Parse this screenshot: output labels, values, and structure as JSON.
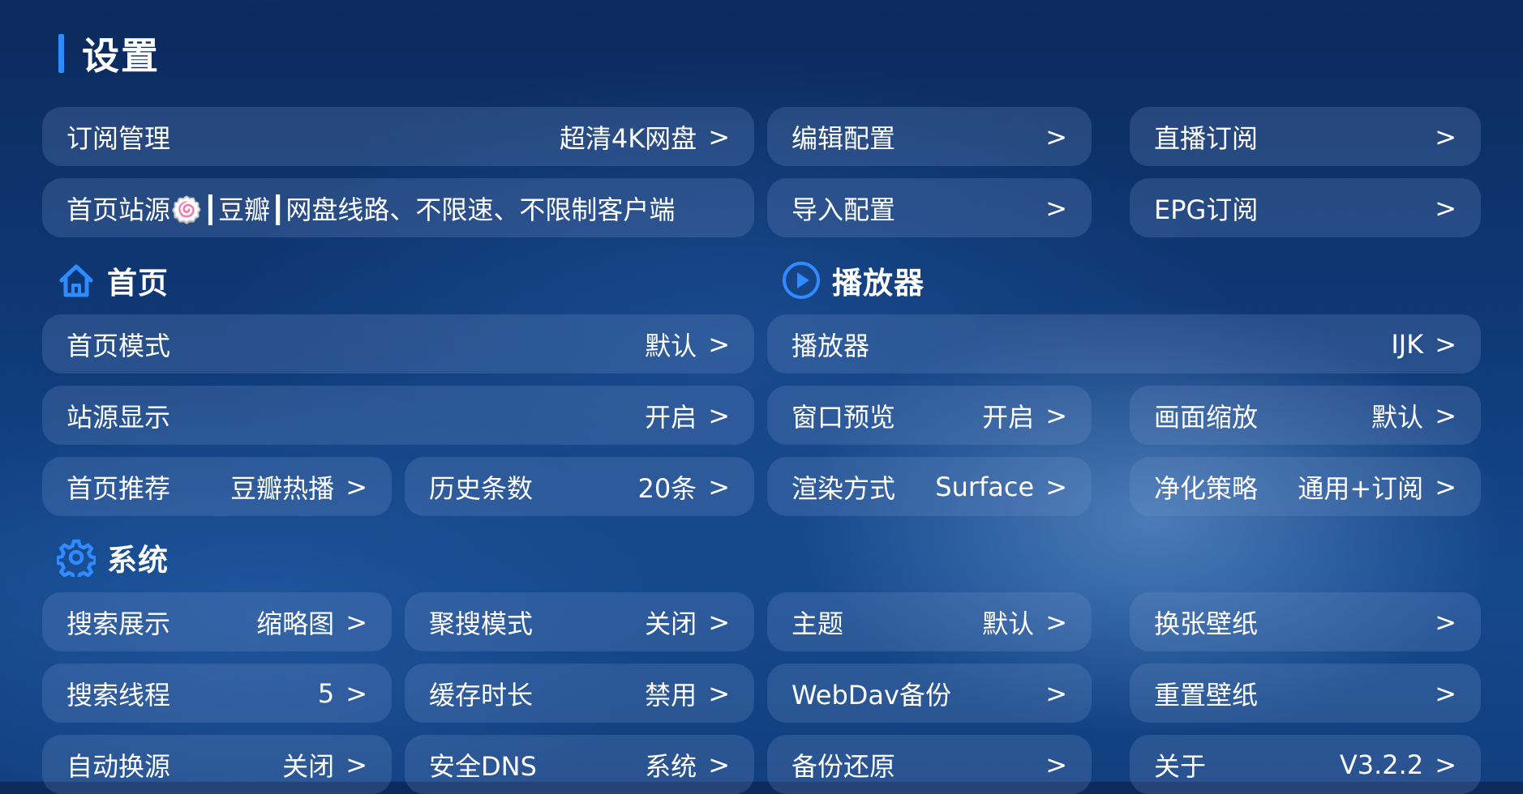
{
  "header": {
    "title": "设置"
  },
  "top": [
    {
      "label": "订阅管理",
      "value": "超清4K网盘"
    },
    {
      "label": "编辑配置",
      "value": ""
    },
    {
      "label": "直播订阅",
      "value": ""
    },
    {
      "label": "首页站源🍥┃豆瓣┃网盘线路、不限速、不限制客户端",
      "value": ""
    },
    {
      "label": "导入配置",
      "value": ""
    },
    {
      "label": "EPG订阅",
      "value": ""
    }
  ],
  "sections": {
    "home": "首页",
    "player": "播放器",
    "system": "系统"
  },
  "home": [
    {
      "label": "首页模式",
      "value": "默认"
    },
    {
      "label": "站源显示",
      "value": "开启"
    },
    {
      "label": "首页推荐",
      "value": "豆瓣热播"
    },
    {
      "label": "历史条数",
      "value": "20条"
    }
  ],
  "player": [
    {
      "label": "播放器",
      "value": "IJK"
    },
    {
      "label": "窗口预览",
      "value": "开启"
    },
    {
      "label": "画面缩放",
      "value": "默认"
    },
    {
      "label": "渲染方式",
      "value": "Surface"
    },
    {
      "label": "净化策略",
      "value": "通用+订阅"
    }
  ],
  "system": [
    {
      "label": "搜索展示",
      "value": "缩略图"
    },
    {
      "label": "聚搜模式",
      "value": "关闭"
    },
    {
      "label": "主题",
      "value": "默认"
    },
    {
      "label": "换张壁纸",
      "value": ""
    },
    {
      "label": "搜索线程",
      "value": "5"
    },
    {
      "label": "缓存时长",
      "value": "禁用"
    },
    {
      "label": "WebDav备份",
      "value": ""
    },
    {
      "label": "重置壁纸",
      "value": ""
    },
    {
      "label": "自动换源",
      "value": "关闭"
    },
    {
      "label": "安全DNS",
      "value": "系统"
    },
    {
      "label": "备份还原",
      "value": ""
    },
    {
      "label": "关于",
      "value": "V3.2.2"
    }
  ],
  "chevron": ">",
  "colors": {
    "accent": "#2f8bff"
  }
}
